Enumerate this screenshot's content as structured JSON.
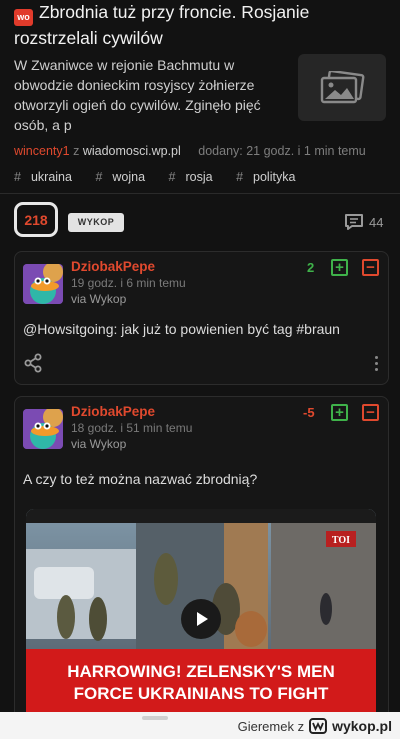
{
  "post": {
    "title": "Zbrodnia tuż przy froncie. Rosjanie rozstrzelali cywilów",
    "badge_text": "wo",
    "lead": "W Zwaniwce w rejonie Bachmutu w obwodzie donieckim rosyjscy żołnierze otworzyli ogień do cywilów. Zginęło pięć osób, a p",
    "author": "wincenty1",
    "via_prefix": "z",
    "source": "wiadomosci.wp.pl",
    "added": "dodany: 21 godz. i 1 min temu",
    "tags": [
      "ukraina",
      "wojna",
      "rosja",
      "polityka"
    ],
    "votes": "218",
    "wykop_label": "WYKOP",
    "comment_count": "44"
  },
  "comments": [
    {
      "user": "DziobakPepe",
      "time": "19 godz. i 6 min temu",
      "via": "via Wykop",
      "score": "2",
      "mention": "@Howsitgoing",
      "text": ": jak już to powienien być tag #braun"
    },
    {
      "user": "DziobakPepe",
      "time": "18 godz. i 51 min temu",
      "via": "via Wykop",
      "score": "-5",
      "text": "A czy to też można nazwać zbrodnią?",
      "video_banner_line1": "HARROWING! ZELENSKY'S MEN",
      "video_banner_line2": "FORCE UKRAINIANS TO FIGHT",
      "video_logo": "TOI"
    }
  ],
  "footer": {
    "credit_prefix": "Gieremek z",
    "logo": "wykop.pl"
  },
  "colors": {
    "accent": "#e0492e",
    "upvote": "#3fb24a",
    "background": "#121212"
  }
}
